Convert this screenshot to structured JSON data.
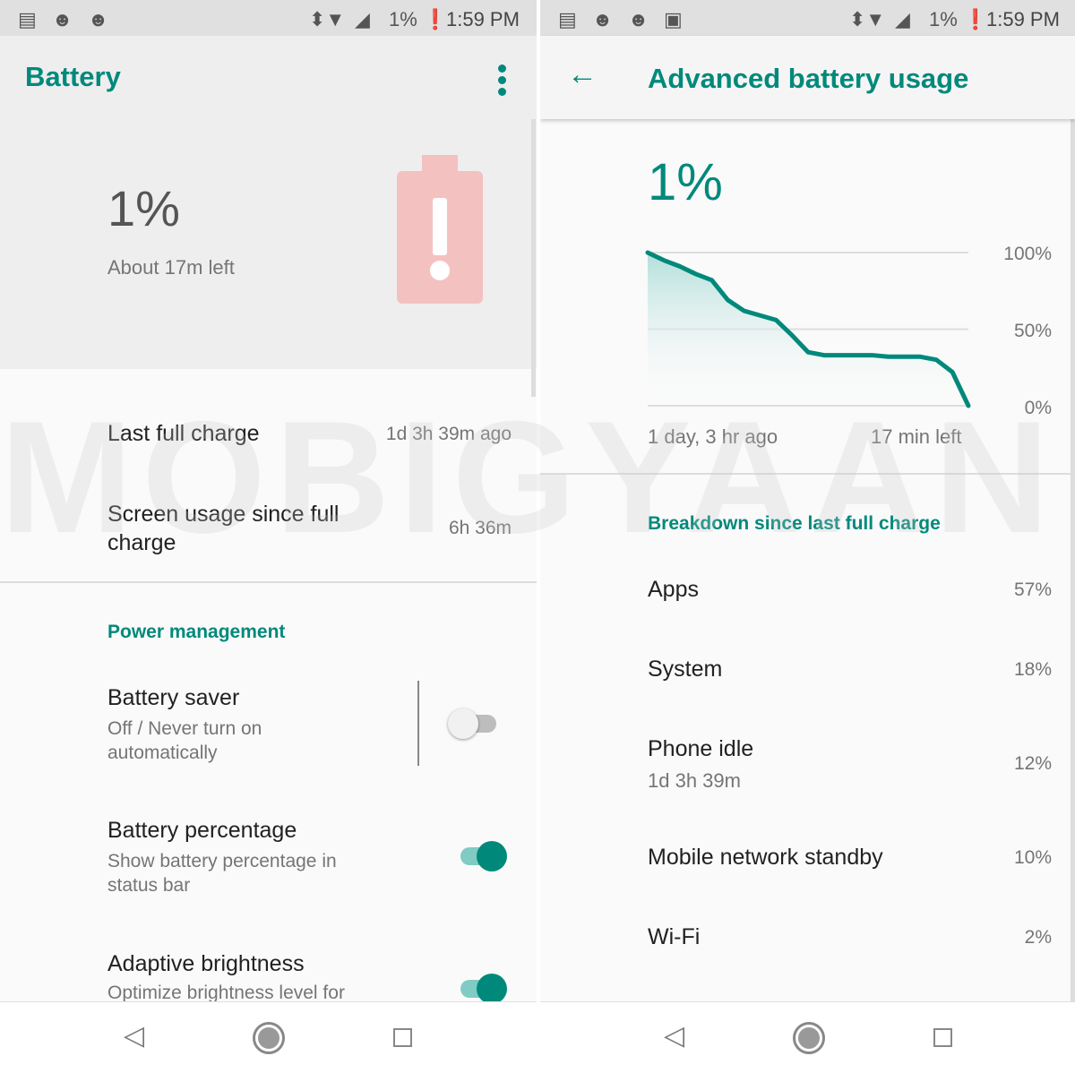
{
  "status_bar": {
    "battery": "1%",
    "time": "1:59 PM",
    "icons": [
      "notes-icon",
      "reddit-icon",
      "reddit-icon",
      "image-icon",
      "data-arrows-icon",
      "wifi-icon",
      "signal-no-sim-icon",
      "battery-alert-icon"
    ]
  },
  "left": {
    "title": "Battery",
    "level": "1%",
    "remaining": "About 17m left",
    "rows": [
      {
        "label": "Last full charge",
        "value": "1d 3h 39m ago"
      },
      {
        "label": "Screen usage since full charge",
        "value": "6h 36m"
      }
    ],
    "section": "Power management",
    "settings": [
      {
        "title": "Battery saver",
        "summary": "Off / Never turn on automatically",
        "on": false
      },
      {
        "title": "Battery percentage",
        "summary": "Show battery percentage in status bar",
        "on": true
      },
      {
        "title": "Adaptive brightness",
        "summary": "Optimize brightness level for",
        "on": true
      }
    ]
  },
  "right": {
    "title": "Advanced battery usage",
    "level": "1%",
    "graph": {
      "type": "area",
      "y_ticks": [
        "100%",
        "50%",
        "0%"
      ],
      "x_start": "1 day, 3 hr ago",
      "x_end": "17 min left",
      "levels": [
        100,
        95,
        91,
        86,
        82,
        69,
        62,
        59,
        56,
        46,
        35,
        33,
        33,
        33,
        33,
        32,
        32,
        32,
        30,
        22,
        0
      ]
    },
    "section": "Breakdown since last full charge",
    "items": [
      {
        "label": "Apps",
        "sub": "",
        "value": "57%"
      },
      {
        "label": "System",
        "sub": "",
        "value": "18%"
      },
      {
        "label": "Phone idle",
        "sub": "1d 3h 39m",
        "value": "12%"
      },
      {
        "label": "Mobile network standby",
        "sub": "",
        "value": "10%"
      },
      {
        "label": "Wi-Fi",
        "sub": "",
        "value": "2%"
      }
    ]
  },
  "colors": {
    "accent": "#00897b",
    "battery_alert": "#f4c1c1"
  },
  "watermark": "MOBIGYAAN"
}
